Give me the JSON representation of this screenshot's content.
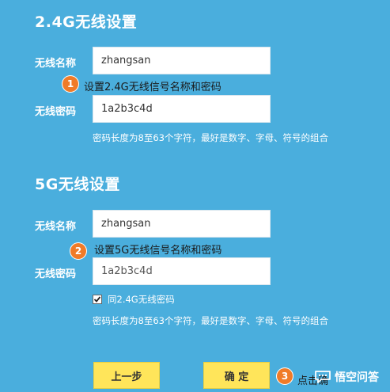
{
  "section_24g": {
    "title": "2.4G无线设置",
    "ssid_label": "无线名称",
    "ssid_value": "zhangsan",
    "annotation_num": "1",
    "annotation_text": "设置2.4G无线信号名称和密码",
    "password_label": "无线密码",
    "password_value": "1a2b3c4d",
    "hint": "密码长度为8至63个字符，最好是数字、字母、符号的组合"
  },
  "section_5g": {
    "title": "5G无线设置",
    "ssid_label": "无线名称",
    "ssid_value": "zhangsan",
    "annotation_num": "2",
    "annotation_text": "设置5G无线信号名称和密码",
    "password_label": "无线密码",
    "password_value": "1a2b3c4d",
    "same_password_checkbox": {
      "checked": true,
      "label": "同2.4G无线密码"
    },
    "hint": "密码长度为8至63个字符，最好是数字、字母、符号的组合"
  },
  "footer": {
    "prev_label": "上一步",
    "confirm_label": "确 定",
    "annotation_num": "3",
    "annotation_text": "点击确",
    "watermark": "悟空问答"
  },
  "colors": {
    "background": "#4aaedd",
    "button": "#ffe55a",
    "badge": "#f07b28"
  }
}
